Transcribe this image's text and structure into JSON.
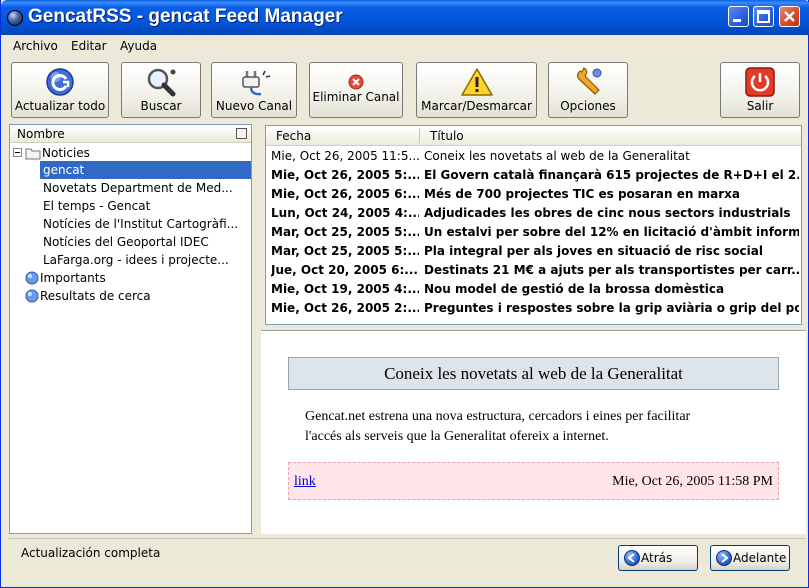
{
  "window": {
    "title": "GencatRSS - gencat Feed Manager"
  },
  "menu": [
    "Archivo",
    "Editar",
    "Ayuda"
  ],
  "toolbar": {
    "update_all": "Actualizar todo",
    "search": "Buscar",
    "new_channel": "Nuevo Canal",
    "delete_channel": "Eliminar Canal",
    "mark_unmark": "Marcar/Desmarcar",
    "options": "Opciones",
    "exit": "Salir"
  },
  "tree": {
    "header": "Nombre",
    "root": "Noticies",
    "items": [
      "gencat",
      "Novetats Department de Med...",
      "El temps - Gencat",
      "Notícies de l'Institut Cartogràfi...",
      "Notícies del Geoportal IDEC",
      "LaFarga.org - idees i projecte..."
    ],
    "other": [
      "Importants",
      "Resultats de cerca"
    ]
  },
  "list": {
    "headers": {
      "date": "Fecha",
      "title": "Título"
    },
    "rows": [
      {
        "date": "Mie, Oct 26, 2005 11:5...",
        "title": "Coneix les novetats al web de la Generalitat",
        "bold": false
      },
      {
        "date": "Mie, Oct 26, 2005 5:...",
        "title": "El Govern català finançarà 615 projectes de R+D+I el 2...",
        "bold": true
      },
      {
        "date": "Mie, Oct 26, 2005 6:...",
        "title": "Més de 700 projectes TIC es posaran en marxa",
        "bold": true
      },
      {
        "date": "Lun, Oct 24, 2005 4:...",
        "title": "Adjudicades les obres de cinc nous sectors industrials",
        "bold": true
      },
      {
        "date": "Mar, Oct 25, 2005 5:...",
        "title": "Un estalvi per sobre del 12% en licitació d'àmbit informà...",
        "bold": true
      },
      {
        "date": "Mar, Oct 25, 2005 5:...",
        "title": "Pla integral per als joves en situació de risc social",
        "bold": true
      },
      {
        "date": "Jue, Oct 20, 2005 6:...",
        "title": "Destinats 21 M€ a ajuts per als transportistes per carr...",
        "bold": true
      },
      {
        "date": "Mie, Oct 19, 2005 4:...",
        "title": "Nou model de gestió de la brossa domèstica",
        "bold": true
      },
      {
        "date": "Mie, Oct 26, 2005 2:...",
        "title": "Preguntes i respostes sobre la grip aviària o grip del pol...",
        "bold": true
      }
    ]
  },
  "detail": {
    "title": "Coneix les novetats al web de la Generalitat",
    "body_line1": "Gencat.net estrena una nova estructura, cercadors i eines per facilitar",
    "body_line2": "l'accés als serveis que la Generalitat ofereix a internet.",
    "link": "link",
    "date": "Mie, Oct 26, 2005 11:58 PM"
  },
  "status": {
    "text": "Actualización completa",
    "back": "Atrás",
    "forward": "Adelante"
  },
  "colors": {
    "selection": "#316ac5",
    "titlebar": "#0453d6"
  }
}
